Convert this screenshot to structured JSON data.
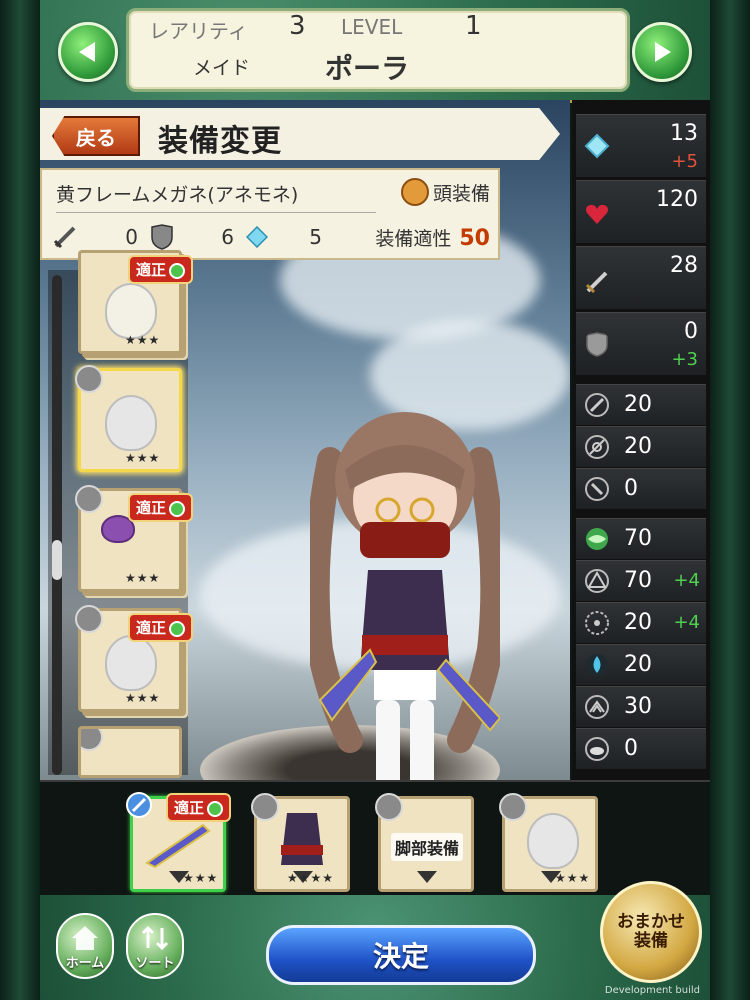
{
  "header": {
    "rarity_label": "レアリティ",
    "rarity_value": "3",
    "level_label": "LEVEL",
    "level_value": "1",
    "class_label": "メイド",
    "character_name": "ポーラ"
  },
  "title_bar": {
    "back_label": "戻る",
    "title": "装備変更"
  },
  "equipment": {
    "name": "黄フレームメガネ(アネモネ)",
    "slot_type": "頭装備",
    "attack": "0",
    "defense": "6",
    "crystal": "5",
    "fit_label": "装備適性",
    "fit_value": "50"
  },
  "inventory": [
    {
      "fit_tag": "適正",
      "stars": "★★★",
      "selected": false
    },
    {
      "fit_tag": "",
      "stars": "★★★",
      "selected": true
    },
    {
      "fit_tag": "適正",
      "stars": "★★★",
      "selected": false
    },
    {
      "fit_tag": "適正",
      "stars": "★★★",
      "selected": false
    }
  ],
  "stats_main": [
    {
      "icon": "crystal-icon",
      "value": "13",
      "delta": "+5",
      "delta_color": "#e0533a"
    },
    {
      "icon": "heart-icon",
      "value": "120",
      "delta": ""
    },
    {
      "icon": "sword-icon",
      "value": "28",
      "delta": ""
    },
    {
      "icon": "shield-icon",
      "value": "0",
      "delta": "+3",
      "delta_color": "#4fd14f"
    }
  ],
  "stats_resist": [
    {
      "icon": "slash-resist-icon",
      "value": "20"
    },
    {
      "icon": "pierce-resist-icon",
      "value": "20"
    },
    {
      "icon": "blunt-resist-icon",
      "value": "0"
    }
  ],
  "stats_element": [
    {
      "icon": "wind-element-icon",
      "value": "70",
      "delta": ""
    },
    {
      "icon": "earth-element-icon",
      "value": "70",
      "delta": "+4"
    },
    {
      "icon": "light-element-icon",
      "value": "20",
      "delta": "+4"
    },
    {
      "icon": "water-element-icon",
      "value": "20",
      "delta": ""
    },
    {
      "icon": "dark-element-icon",
      "value": "30",
      "delta": ""
    },
    {
      "icon": "cloud-element-icon",
      "value": "0",
      "delta": ""
    }
  ],
  "slots": [
    {
      "name": "weapon",
      "fit_tag": "適正",
      "stars": "★★★",
      "label": ""
    },
    {
      "name": "body",
      "fit_tag": "",
      "stars": "★★★★",
      "label": ""
    },
    {
      "name": "legs",
      "fit_tag": "",
      "stars": "",
      "label": "脚部装備"
    },
    {
      "name": "head",
      "fit_tag": "",
      "stars": "★★★",
      "label": ""
    }
  ],
  "footer": {
    "home_label": "ホーム",
    "sort_label": "ソート",
    "decide_label": "決定",
    "auto_label_1": "おまかせ",
    "auto_label_2": "装備"
  },
  "watermark": "Development build",
  "colors": {
    "accent_green": "#2b6b4b",
    "fit_red": "#c43b00",
    "positive": "#4fd14f",
    "negative": "#e0533a"
  }
}
